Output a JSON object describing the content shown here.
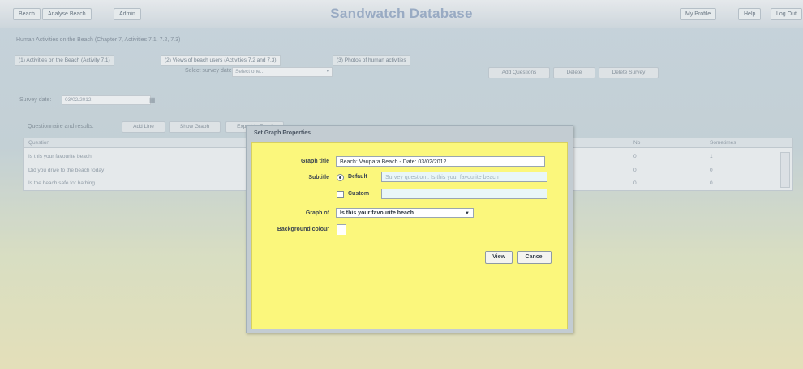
{
  "app": {
    "title": "Sandwatch Database"
  },
  "nav": {
    "left": [
      "Beach",
      "Analyse Beach",
      "Admin"
    ],
    "right": [
      "My Profile",
      "Help",
      "Log Out"
    ]
  },
  "breadcrumb": "Human Activities on the Beach (Chapter 7, Activities 7.1, 7.2, 7.3)",
  "tabs": [
    "(1) Activities on the Beach (Activity 7.1)",
    "(2) Views of beach users (Activities 7.2 and 7.3)",
    "(3) Photos of human activities"
  ],
  "survey_select": {
    "label": "Select survey date:",
    "value": "Select one..."
  },
  "survey_actions": [
    "Add Questions",
    "Delete",
    "Delete Survey"
  ],
  "survey_date": {
    "label": "Survey date:",
    "value": "03/02/2012"
  },
  "question_toolbar": {
    "label": "Questionnaire and results:",
    "add": "Add Line",
    "show_graph": "Show Graph",
    "export": "Export to Excel"
  },
  "grid": {
    "headers": [
      "Question",
      "No",
      "Sometimes"
    ],
    "rows": [
      {
        "question": "Is this your favourite beach",
        "no": "0",
        "sometimes": "1"
      },
      {
        "question": "Did you drive to the beach today",
        "no": "0",
        "sometimes": "0"
      },
      {
        "question": "Is the beach safe for bathing",
        "no": "0",
        "sometimes": "0"
      }
    ]
  },
  "dialog": {
    "title": "Set Graph Properties",
    "graph_title_label": "Graph title",
    "graph_title_value": "Beach: Vaupara Beach  - Date: 03/02/2012",
    "subtitle_label": "Subtitle",
    "default_label": "Default",
    "default_value": "Survey question : Is this your favourite beach",
    "custom_label": "Custom",
    "custom_value": "",
    "graph_of_label": "Graph of",
    "graph_of_value": "Is this your favourite beach",
    "bg_colour_label": "Background colour",
    "view_button": "View",
    "cancel_button": "Cancel"
  }
}
